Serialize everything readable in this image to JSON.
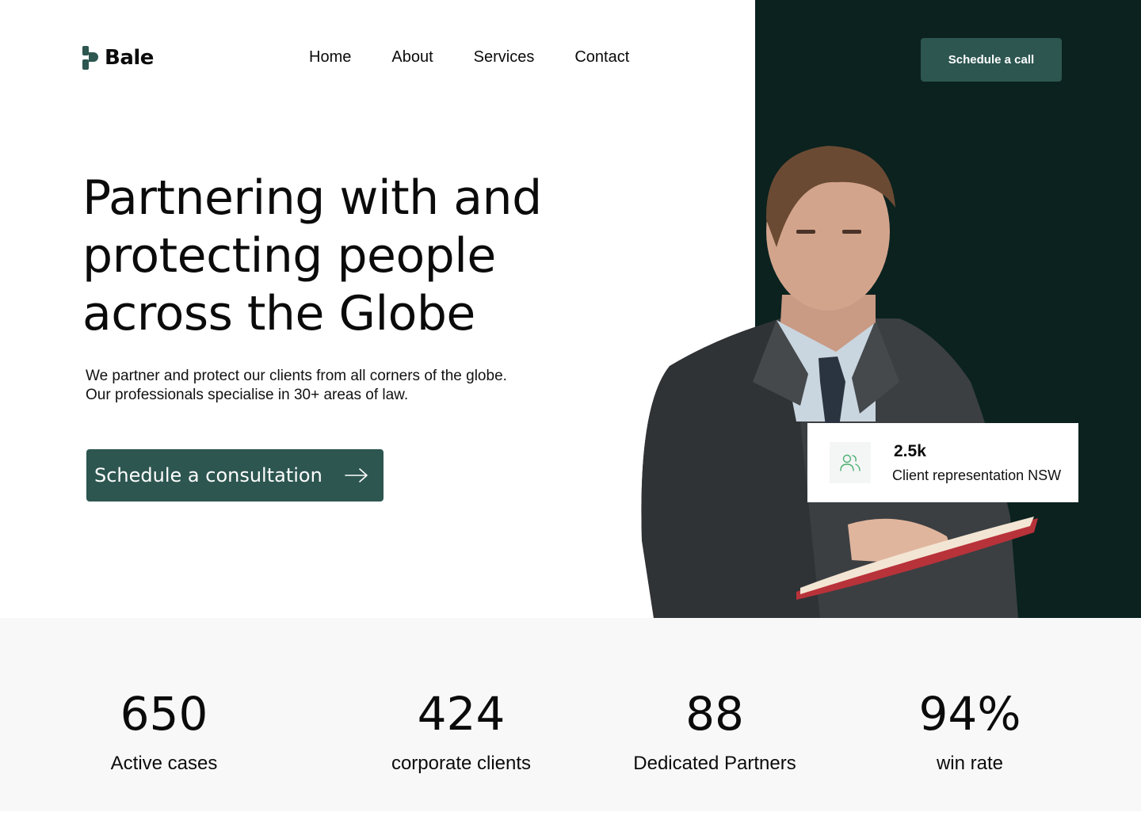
{
  "brand": {
    "name": "Bale",
    "accent": "#2d5650",
    "dark": "#0b221f",
    "icon_green": "#4caf72"
  },
  "nav": {
    "items": [
      "Home",
      "About",
      "Services",
      "Contact"
    ]
  },
  "header": {
    "cta_label": "Schedule a call"
  },
  "hero": {
    "title": "Partnering with and protecting people across the Globe",
    "subtitle": "We partner and protect our clients from all corners of the globe. Our professionals specialise in 30+ areas of law.",
    "cta_label": "Schedule a consultation",
    "cta_icon": "arrow-right-icon"
  },
  "stat_card": {
    "value": "2.5k",
    "label": "Client representation NSW",
    "icon": "users-icon"
  },
  "stats": [
    {
      "value": "650",
      "label": "Active cases"
    },
    {
      "value": "424",
      "label": "corporate clients"
    },
    {
      "value": "88",
      "label": "Dedicated Partners"
    },
    {
      "value": "94%",
      "label": "win rate"
    }
  ]
}
